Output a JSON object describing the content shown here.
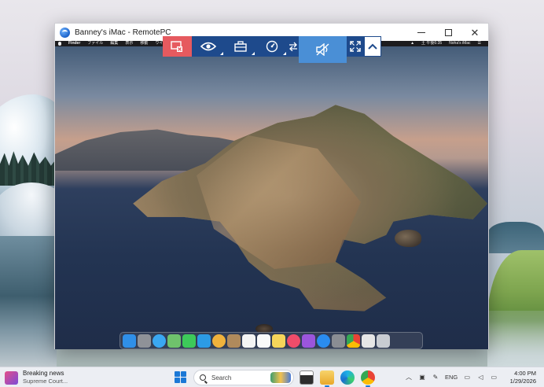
{
  "window": {
    "title": "Banney's iMac - RemotePC",
    "min_symbol": "",
    "close_symbol": "✕"
  },
  "mac_menubar": {
    "items": [
      "Finder",
      "ファイル",
      "編集",
      "表示",
      "移動",
      "ウイン"
    ],
    "right_items": [
      "▲",
      "土 午後6:35",
      "Noha's iMac",
      "☰"
    ]
  },
  "remote_toolbar": {
    "buttons": [
      "disconnect",
      "view",
      "actions",
      "quality",
      "file-transfer",
      "sound",
      "full-screen",
      "collapse"
    ]
  },
  "mac_dock": {
    "icons": [
      {
        "name": "finder",
        "color": "#2f8fe8"
      },
      {
        "name": "launchpad",
        "color": "#8f9298"
      },
      {
        "name": "safari",
        "color": "#3aa7f2"
      },
      {
        "name": "maps",
        "color": "#6fc26c"
      },
      {
        "name": "messages",
        "color": "#3dc95a"
      },
      {
        "name": "facetime",
        "color": "#2c9be6"
      },
      {
        "name": "photos",
        "color": "#f0b23c"
      },
      {
        "name": "contacts",
        "color": "#b08a5c"
      },
      {
        "name": "calendar",
        "color": "#f4f4f4"
      },
      {
        "name": "reminders",
        "color": "#fafafa"
      },
      {
        "name": "notes",
        "color": "#f6d55a"
      },
      {
        "name": "music",
        "color": "#f04c6a"
      },
      {
        "name": "podcasts",
        "color": "#9b55dc"
      },
      {
        "name": "app-store",
        "color": "#2a8cf0"
      },
      {
        "name": "system-preferences",
        "color": "#8a8d93"
      },
      {
        "name": "chrome",
        "color": "#e9e9e9"
      },
      {
        "name": "documents",
        "color": "#e6e6e6"
      },
      {
        "name": "trash",
        "color": "#c8ccd2"
      }
    ]
  },
  "taskbar": {
    "news_title": "Breaking news",
    "news_sub": "Supreme Court...",
    "search_placeholder": "Search",
    "apps": [
      {
        "name": "file-explorer",
        "color": "#2d2d2d"
      },
      {
        "name": "folder",
        "color": "#f5c04a"
      },
      {
        "name": "edge",
        "color": "#1f9bdc"
      },
      {
        "name": "chrome",
        "color": "#e94335"
      }
    ],
    "tray": {
      "language": "ENG"
    },
    "time": "4:00 PM",
    "date": "1/29/2026"
  }
}
